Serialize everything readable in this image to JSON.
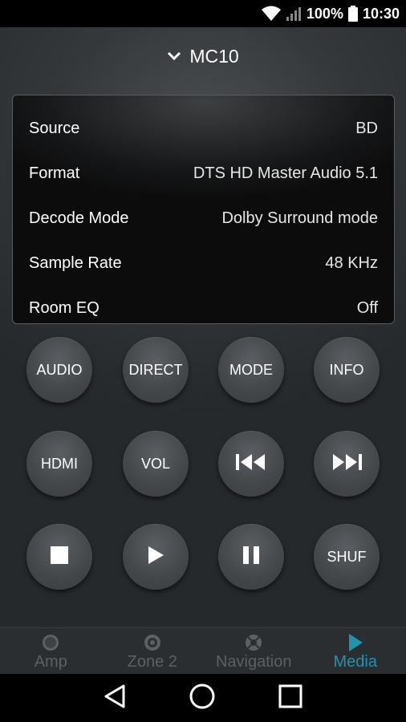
{
  "status_bar": {
    "battery": "100%",
    "time": "10:30",
    "icons": [
      "wifi-icon",
      "signal-icon",
      "battery-icon"
    ]
  },
  "header": {
    "title": "MC10",
    "icon": "chevron-down-icon"
  },
  "info": {
    "rows": [
      {
        "label": "Source",
        "value": "BD"
      },
      {
        "label": "Format",
        "value": "DTS HD Master Audio 5.1"
      },
      {
        "label": "Decode Mode",
        "value": "Dolby Surround mode"
      },
      {
        "label": "Sample Rate",
        "value": "48 KHz"
      },
      {
        "label": "Room EQ",
        "value": "Off"
      }
    ]
  },
  "buttons": {
    "audio": "AUDIO",
    "direct": "DIRECT",
    "mode": "MODE",
    "info": "INFO",
    "hdmi": "HDMI",
    "vol": "VOL",
    "shuf": "SHUF",
    "icons": [
      "previous-track-icon",
      "next-track-icon",
      "stop-icon",
      "play-icon",
      "pause-icon"
    ]
  },
  "tabs": [
    {
      "label": "Amp",
      "icon": "amp-icon"
    },
    {
      "label": "Zone 2",
      "icon": "zone-icon"
    },
    {
      "label": "Navigation",
      "icon": "navigation-icon"
    },
    {
      "label": "Media",
      "icon": "media-play-icon",
      "active": true
    }
  ],
  "colors": {
    "accent": "#1e94b0",
    "inactive_tab": "#5c6063",
    "background": "#2c2f31"
  },
  "android_nav": [
    "back-icon",
    "home-icon",
    "recents-icon"
  ]
}
